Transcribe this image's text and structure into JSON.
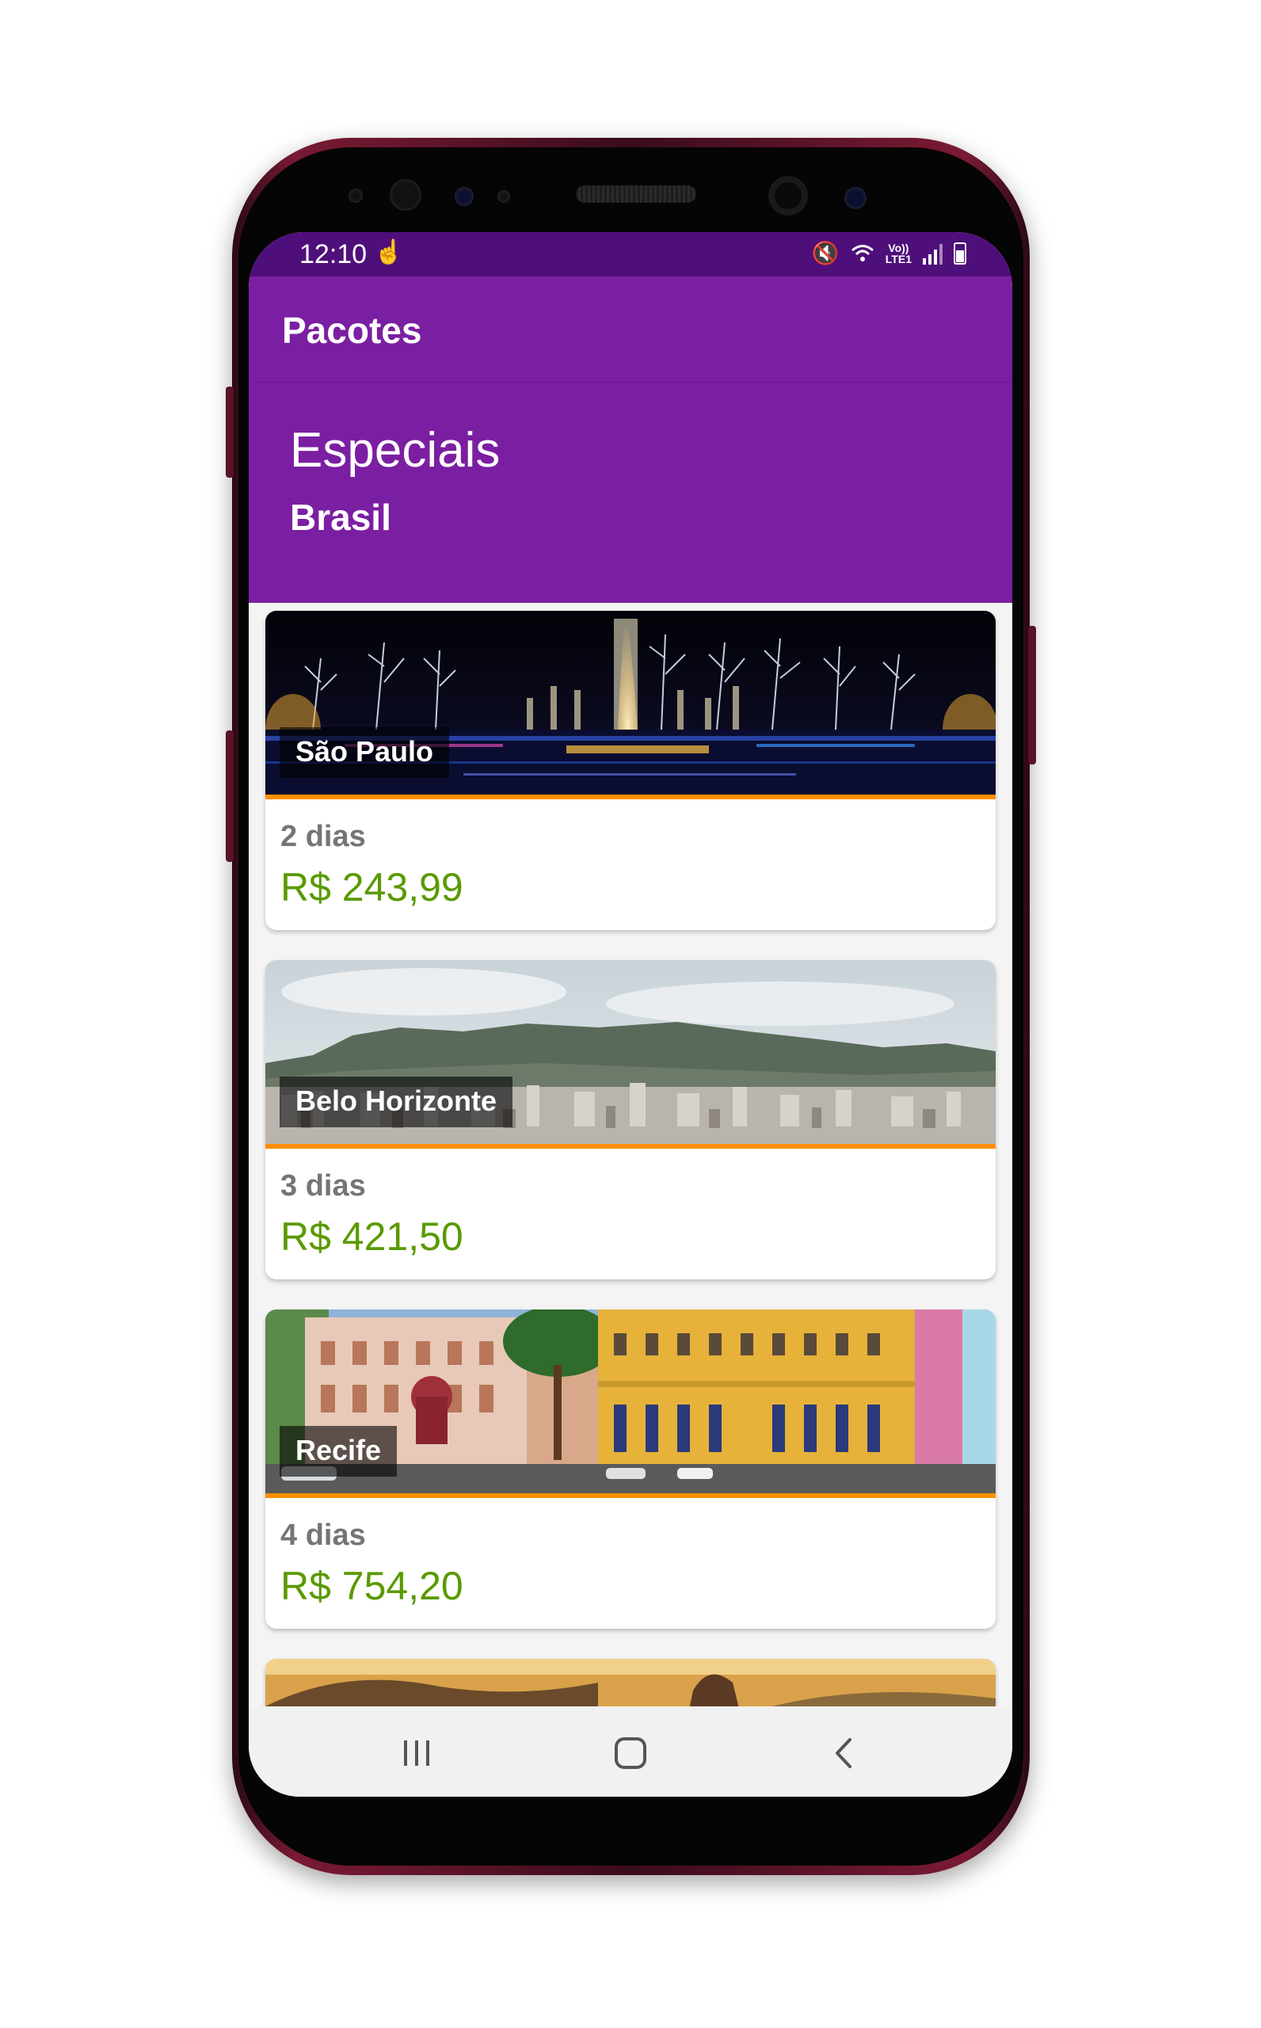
{
  "status_bar": {
    "time": "12:10",
    "icons": [
      "touch-icon",
      "mute-icon",
      "wifi-icon",
      "volte-icon",
      "signal-icon",
      "battery-icon"
    ],
    "network_label_top": "Vo))",
    "network_label_bottom": "LTE1"
  },
  "app_bar": {
    "title": "Pacotes"
  },
  "header": {
    "title": "Especiais",
    "subtitle": "Brasil"
  },
  "packages": [
    {
      "city": "São Paulo",
      "duration": "2 dias",
      "price": "R$  243,99",
      "image": "night-fountain-photo"
    },
    {
      "city": "Belo Horizonte",
      "duration": "3 dias",
      "price": "R$  421,50",
      "image": "city-mountain-photo"
    },
    {
      "city": "Recife",
      "duration": "4 dias",
      "price": "R$  754,20",
      "image": "colonial-buildings-photo"
    },
    {
      "image": "bay-sunset-photo"
    }
  ],
  "nav_bar": {
    "icons": [
      "recents-icon",
      "home-icon",
      "back-icon"
    ]
  },
  "colors": {
    "primary": "#7b1fa2",
    "status_bar": "#4e0f7a",
    "accent_stripe": "#ff8f00",
    "price_text": "#5a9a00",
    "duration_text": "#757575"
  }
}
